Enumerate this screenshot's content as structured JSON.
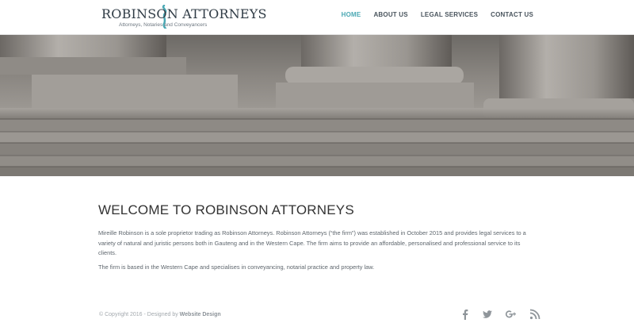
{
  "header": {
    "logo_title": "ROBINSON ATTORNEYS",
    "logo_subtitle": "Attorneys, Notaries and Conveyancers",
    "nav": [
      {
        "label": "HOME",
        "active": true
      },
      {
        "label": "ABOUT US",
        "active": false
      },
      {
        "label": "LEGAL SERVICES",
        "active": false
      },
      {
        "label": "CONTACT US",
        "active": false
      }
    ]
  },
  "main": {
    "heading": "WELCOME TO ROBINSON ATTORNEYS",
    "paragraph1": "Mireille Robinson is a sole proprietor trading as Robinson Attorneys. Robinson Attorneys (“the firm”) was established in October 2015 and provides legal services to a variety of natural and juristic persons both in Gauteng and in the Western Cape. The firm aims to provide an affordable, personalised and professional service to its clients.",
    "paragraph2": "The firm is based in the Western Cape and specialises in conveyancing, notarial practice and property law."
  },
  "footer": {
    "copyright_prefix": "© Copyright 2016 - Designed by",
    "designer": "Website Design",
    "socials": [
      "facebook-icon",
      "twitter-icon",
      "google-plus-icon",
      "rss-icon"
    ]
  },
  "colors": {
    "accent": "#4aa8b3",
    "nav_text": "#49545d",
    "heading": "#333333",
    "social_icons": "#8f959a"
  }
}
